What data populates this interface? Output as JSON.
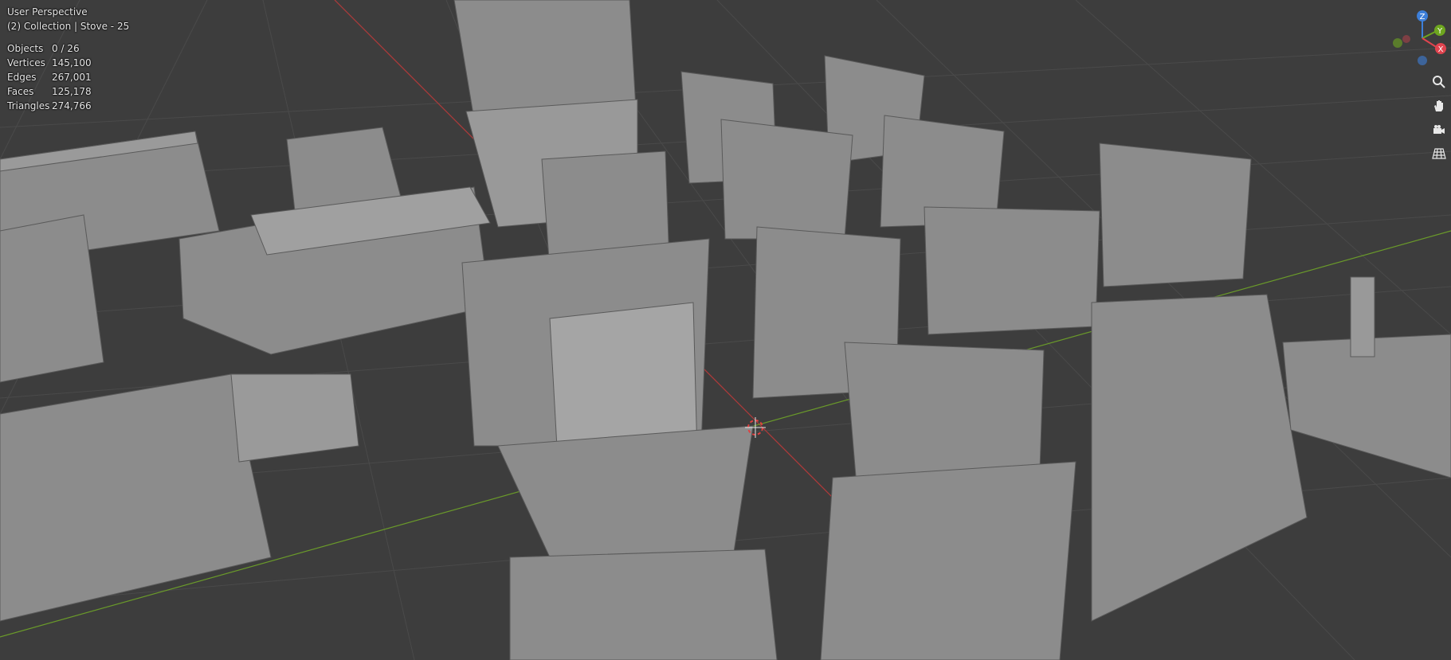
{
  "viewport": {
    "view_name": "User Perspective",
    "collection_line": "(2) Collection | Stove - 25",
    "stats": [
      {
        "label": "Objects",
        "value": "0 / 26"
      },
      {
        "label": "Vertices",
        "value": "145,100"
      },
      {
        "label": "Edges",
        "value": "267,001"
      },
      {
        "label": "Faces",
        "value": "125,178"
      },
      {
        "label": "Triangles",
        "value": "274,766"
      }
    ]
  },
  "gizmo": {
    "x_label": "X",
    "y_label": "Y",
    "z_label": "Z",
    "colors": {
      "x": "#e0444f",
      "y": "#6ea61f",
      "z": "#3d7fd9"
    }
  },
  "nav_tools": [
    {
      "icon": "zoom-icon"
    },
    {
      "icon": "hand-pan-icon"
    },
    {
      "icon": "camera-icon"
    },
    {
      "icon": "grid-perspective-icon"
    }
  ],
  "colors": {
    "background": "#3d3d3d",
    "grid": "#4a4a4a",
    "x_axis": "#b03a3a",
    "y_axis": "#6a9a2a",
    "model": "#8c8c8c"
  }
}
